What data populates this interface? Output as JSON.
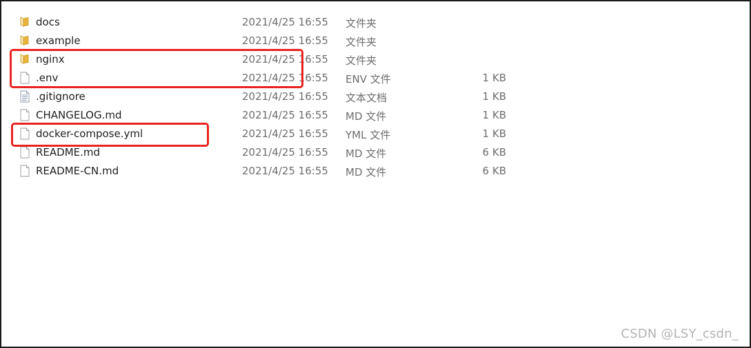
{
  "files": [
    {
      "name": "docs",
      "date": "2021/4/25 16:55",
      "type": "文件夹",
      "size": "",
      "icon": "folder-icon"
    },
    {
      "name": "example",
      "date": "2021/4/25 16:55",
      "type": "文件夹",
      "size": "",
      "icon": "folder-icon"
    },
    {
      "name": "nginx",
      "date": "2021/4/25 16:55",
      "type": "文件夹",
      "size": "",
      "icon": "folder-icon"
    },
    {
      "name": ".env",
      "date": "2021/4/25 16:55",
      "type": "ENV 文件",
      "size": "1 KB",
      "icon": "blank-file-icon"
    },
    {
      "name": ".gitignore",
      "date": "2021/4/25 16:55",
      "type": "文本文档",
      "size": "1 KB",
      "icon": "text-document-icon"
    },
    {
      "name": "CHANGELOG.md",
      "date": "2021/4/25 16:55",
      "type": "MD 文件",
      "size": "1 KB",
      "icon": "blank-file-icon"
    },
    {
      "name": "docker-compose.yml",
      "date": "2021/4/25 16:55",
      "type": "YML 文件",
      "size": "1 KB",
      "icon": "blank-file-icon"
    },
    {
      "name": "README.md",
      "date": "2021/4/25 16:55",
      "type": "MD 文件",
      "size": "6 KB",
      "icon": "blank-file-icon"
    },
    {
      "name": "README-CN.md",
      "date": "2021/4/25 16:55",
      "type": "MD 文件",
      "size": "6 KB",
      "icon": "blank-file-icon"
    }
  ],
  "watermark": "CSDN @LSY_csdn_",
  "colors": {
    "highlight": "#e8231f",
    "folder": "#e8b53a",
    "text": "#1e1e1e",
    "muted": "#6d6d6d",
    "watermark": "#b3b3b3"
  }
}
